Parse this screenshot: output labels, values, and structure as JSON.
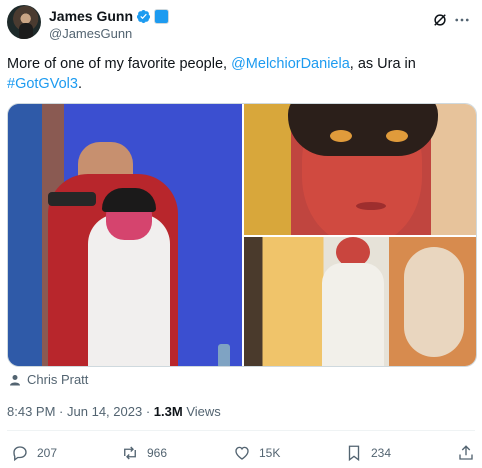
{
  "author": {
    "display_name": "James Gunn",
    "handle": "@JamesGunn",
    "avatar_icon": "avatar-photo",
    "verified_icon": "verified-badge-icon",
    "affiliation_icon": "affiliation-badge-icon"
  },
  "tweet": {
    "text_before": "More of one of my favorite people, ",
    "mention": "@MelchiorDaniela",
    "text_middle": ", as Ura in",
    "hashtag": "#GotGVol3",
    "text_after": "."
  },
  "media": {
    "tagged_person": "Chris Pratt"
  },
  "meta": {
    "time": "8:43 PM",
    "separator": "·",
    "date": "Jun 14, 2023",
    "views_count": "1.3M",
    "views_label": "Views"
  },
  "actions": {
    "reply_count": "207",
    "repost_count": "966",
    "like_count": "15K",
    "bookmark_count": "234"
  },
  "colors": {
    "accent": "#1d9bf0",
    "text": "#0f1419",
    "secondary": "#536471"
  }
}
